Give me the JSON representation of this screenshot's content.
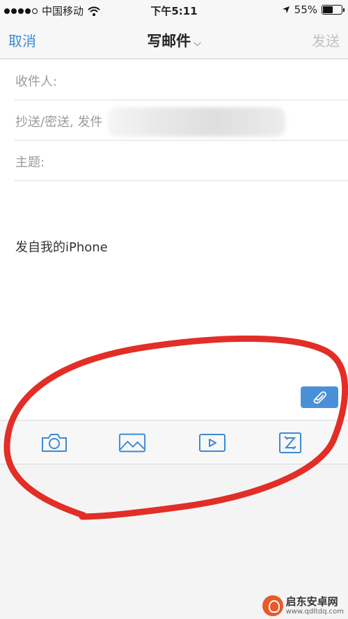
{
  "status_bar": {
    "carrier": "中国移动",
    "time": "下午5:11",
    "battery": "55%",
    "battery_level": 0.55,
    "signal_bars": 4,
    "icons": {
      "wifi": "wifi-icon",
      "location": "location-arrow-icon",
      "battery": "battery-icon"
    }
  },
  "nav": {
    "cancel": "取消",
    "title": "写邮件",
    "title_chevron": "⌵",
    "send": "发送"
  },
  "fields": {
    "to_label": "收件人:",
    "cc_label": "抄送/密送, 发件",
    "subject_label": "主题:"
  },
  "body": {
    "signature": "发自我的iPhone"
  },
  "toolbar": {
    "items": [
      "camera-icon",
      "photo-icon",
      "video-icon",
      "scan-icon"
    ],
    "attach_icon": "paperclip-icon"
  },
  "colors": {
    "accent": "#3a8ad6",
    "send_disabled": "#c0c0c0",
    "attach_bg": "#4a90d9",
    "annotation": "#e0231a"
  },
  "watermark": {
    "name": "启东安卓网",
    "url": "www.qdltdq.com"
  }
}
